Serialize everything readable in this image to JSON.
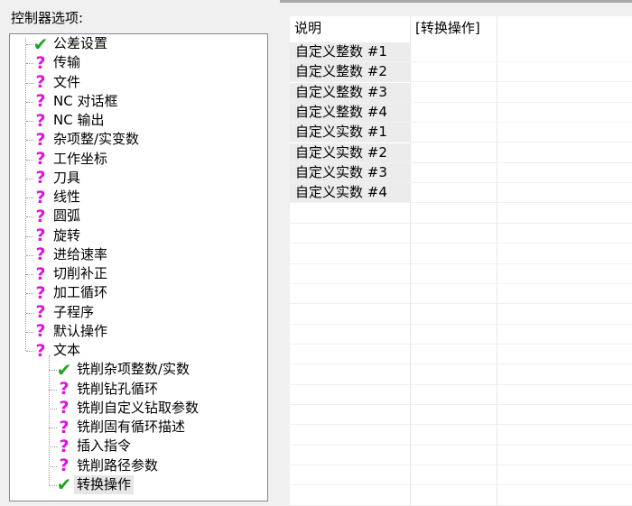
{
  "group": {
    "label": "控制器选项:"
  },
  "tree": {
    "items": [
      {
        "label": "公差设置",
        "icon": "check-icon"
      },
      {
        "label": "传输",
        "icon": "question-icon"
      },
      {
        "label": "文件",
        "icon": "question-icon"
      },
      {
        "label": "NC 对话框",
        "icon": "question-icon"
      },
      {
        "label": "NC 输出",
        "icon": "question-icon"
      },
      {
        "label": "杂项整/实变数",
        "icon": "question-icon"
      },
      {
        "label": "工作坐标",
        "icon": "question-icon"
      },
      {
        "label": "刀具",
        "icon": "question-icon"
      },
      {
        "label": "线性",
        "icon": "question-icon"
      },
      {
        "label": "圆弧",
        "icon": "question-icon"
      },
      {
        "label": "旋转",
        "icon": "question-icon"
      },
      {
        "label": "进给速率",
        "icon": "question-icon"
      },
      {
        "label": "切削补正",
        "icon": "question-icon"
      },
      {
        "label": "加工循环",
        "icon": "question-icon"
      },
      {
        "label": "子程序",
        "icon": "question-icon"
      },
      {
        "label": "默认操作",
        "icon": "question-icon"
      },
      {
        "label": "文本",
        "icon": "question-icon"
      }
    ],
    "children": [
      {
        "label": "铣削杂项整数/实数",
        "icon": "check-icon"
      },
      {
        "label": "铣削钻孔循环",
        "icon": "question-icon"
      },
      {
        "label": "铣削自定义钻取参数",
        "icon": "question-icon"
      },
      {
        "label": "铣削固有循环描述",
        "icon": "question-icon"
      },
      {
        "label": "插入指令",
        "icon": "question-icon"
      },
      {
        "label": "铣削路径参数",
        "icon": "question-icon"
      },
      {
        "label": "转换操作",
        "icon": "check-icon",
        "selected": true
      }
    ]
  },
  "grid": {
    "headers": [
      "说明",
      "[转换操作]",
      ""
    ],
    "rows": [
      "自定义整数 #1",
      "自定义整数 #2",
      "自定义整数 #3",
      "自定义整数 #4",
      "自定义实数 #1",
      "自定义实数 #2",
      "自定义实数 #3",
      "自定义实数 #4"
    ]
  }
}
